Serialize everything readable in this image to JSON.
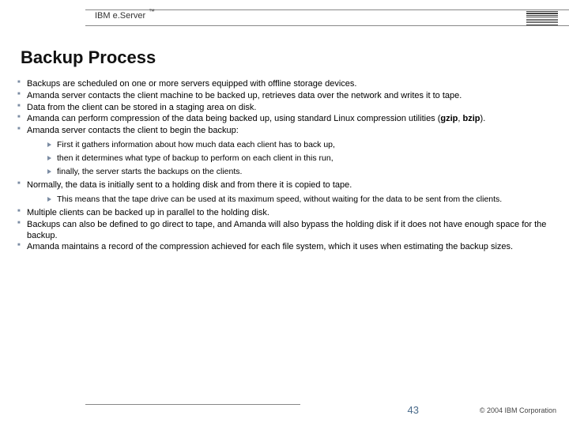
{
  "header": {
    "brand": "IBM e.Server",
    "tm": "™",
    "logo_name": "ibm-logo"
  },
  "slide": {
    "title": "Backup Process"
  },
  "bullets": [
    {
      "text": "Backups are scheduled on one or more servers equipped with offline storage devices."
    },
    {
      "text": "Amanda server contacts the client machine to be backed up, retrieves data over the network and writes it to tape."
    },
    {
      "text": "Data from the client can be stored in a staging area on disk."
    },
    {
      "html": "Amanda can perform compression of the data being backed up, using standard Linux compression utilities (<span class=\"bold\">gzip</span>, <span class=\"bold\">bzip</span>)."
    },
    {
      "text": "Amanda server contacts the client to begin the backup:",
      "children": [
        {
          "text": "First it gathers information about how much data each client has to back up,"
        },
        {
          "text": "then it determines what type of backup to perform on each client in this run,"
        },
        {
          "text": "finally, the server starts the backups on the clients."
        }
      ]
    },
    {
      "text": "Normally, the data is initially sent to a holding disk and from there it is copied to tape.",
      "children": [
        {
          "text": "This means that the tape drive can be used at its maximum speed, without waiting for the data to be sent from the clients."
        }
      ]
    },
    {
      "text": "Multiple clients can be backed up in parallel to the holding disk."
    },
    {
      "text": "Backups can also be defined to go direct to tape, and Amanda will also bypass the holding disk if it does not have enough space for the backup."
    },
    {
      "text": "Amanda maintains a record of the compression achieved for each file system, which it uses when estimating the backup sizes."
    }
  ],
  "footer": {
    "page": "43",
    "copyright": "© 2004 IBM Corporation"
  }
}
